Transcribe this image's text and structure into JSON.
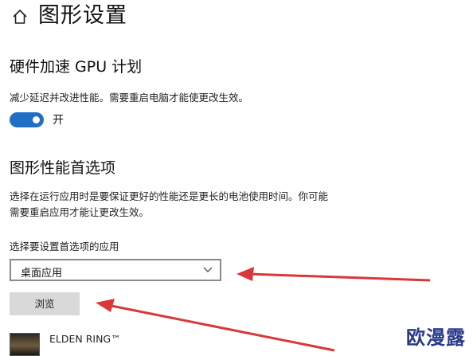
{
  "header": {
    "title": "图形设置",
    "home_icon": "home-icon"
  },
  "hardware_accel": {
    "title": "硬件加速 GPU 计划",
    "description": "减少延迟并改进性能。需要重启电脑才能使更改生效。",
    "toggle_state": "on",
    "toggle_label": "开"
  },
  "graphics_pref": {
    "title": "图形性能首选项",
    "description_line1": "选择在运行应用时是要保证更好的性能还是更长的电池使用时间。你可能",
    "description_line2": "需要重启应用才能让更改生效。",
    "select_label": "选择要设置首选项的应用",
    "select_value": "桌面应用",
    "browse_label": "浏览"
  },
  "app_list": [
    {
      "name": "ELDEN RING™"
    }
  ],
  "watermark": "欧漫露",
  "colors": {
    "accent": "#1f6fc7",
    "annotation_arrow": "#d8383a",
    "watermark": "#2a3a8c"
  }
}
